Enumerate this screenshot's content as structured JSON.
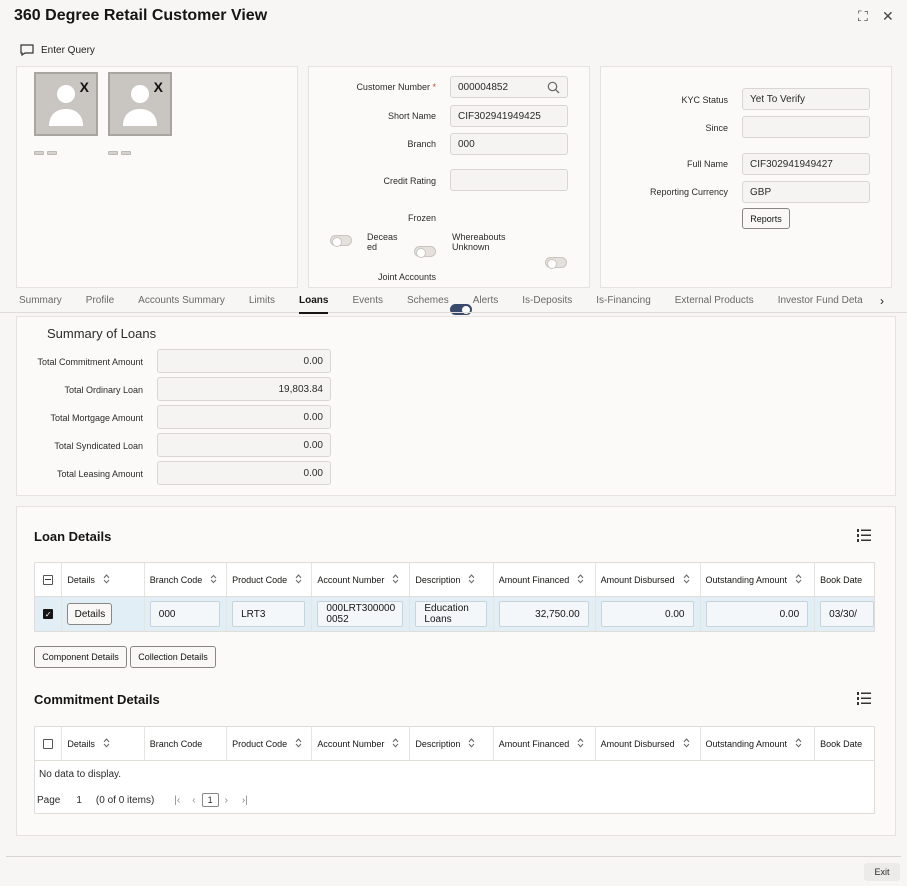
{
  "window": {
    "title": "360 Degree Retail Customer View",
    "restore_glyph": "⛶",
    "close_glyph": "✕"
  },
  "toolbar": {
    "enter_query": "Enter Query"
  },
  "photos": {
    "close_mark": "X"
  },
  "customer": {
    "customer_number_label": "Customer Number",
    "customer_number_required": "*",
    "customer_number": "000004852",
    "short_name_label": "Short Name",
    "short_name": "CIF302941949425",
    "branch_label": "Branch",
    "branch": "000",
    "credit_rating_label": "Credit Rating",
    "credit_rating": "",
    "frozen_label": "Frozen",
    "deceased_label_1": "Deceas",
    "deceased_label_2": "ed",
    "whereabouts_label_1": "Whereabouts",
    "whereabouts_label_2": "Unknown",
    "joint_accounts_label": "Joint Accounts"
  },
  "kyc": {
    "kyc_status_label": "KYC Status",
    "kyc_status": "Yet To Verify",
    "since_label": "Since",
    "since": "",
    "full_name_label": "Full Name",
    "full_name": "CIF302941949427",
    "reporting_currency_label": "Reporting Currency",
    "reporting_currency": "GBP",
    "reports_button": "Reports"
  },
  "tabs": [
    "Summary",
    "Profile",
    "Accounts Summary",
    "Limits",
    "Loans",
    "Events",
    "Schemes",
    "Alerts",
    "Is-Deposits",
    "Is-Financing",
    "External Products",
    "Investor Fund Deta"
  ],
  "active_tab": "Loans",
  "summary": {
    "title": "Summary of Loans",
    "rows": [
      {
        "label": "Total Commitment Amount",
        "value": "0.00"
      },
      {
        "label": "Total Ordinary Loan",
        "value": "19,803.84"
      },
      {
        "label": "Total Mortgage Amount",
        "value": "0.00"
      },
      {
        "label": "Total Syndicated Loan",
        "value": "0.00"
      },
      {
        "label": "Total Leasing Amount",
        "value": "0.00"
      }
    ]
  },
  "loan_details": {
    "title": "Loan Details",
    "columns": [
      "Details",
      "Branch Code",
      "Product Code",
      "Account Number",
      "Description",
      "Amount Financed",
      "Amount Disbursed",
      "Outstanding Amount",
      "Book Date"
    ],
    "row": {
      "details_button": "Details",
      "branch_code": "000",
      "product_code": "LRT3",
      "account_number_1": "000LRT300000",
      "account_number_2": "0052",
      "description_1": "Education",
      "description_2": "Loans",
      "amount_financed": "32,750.00",
      "amount_disbursed": "0.00",
      "outstanding_amount": "0.00",
      "book_date": "03/30/"
    },
    "component_button": "Component Details",
    "collection_button": "Collection Details"
  },
  "commitment_details": {
    "title": "Commitment Details",
    "columns": [
      "Details",
      "Branch Code",
      "Product Code",
      "Account Number",
      "Description",
      "Amount Financed",
      "Amount Disbursed",
      "Outstanding Amount",
      "Book Date"
    ],
    "empty": "No data to display.",
    "page_label": "Page",
    "page": "1",
    "items": "(0 of 0 items)",
    "current_page": "1"
  },
  "footer": {
    "exit": "Exit"
  }
}
